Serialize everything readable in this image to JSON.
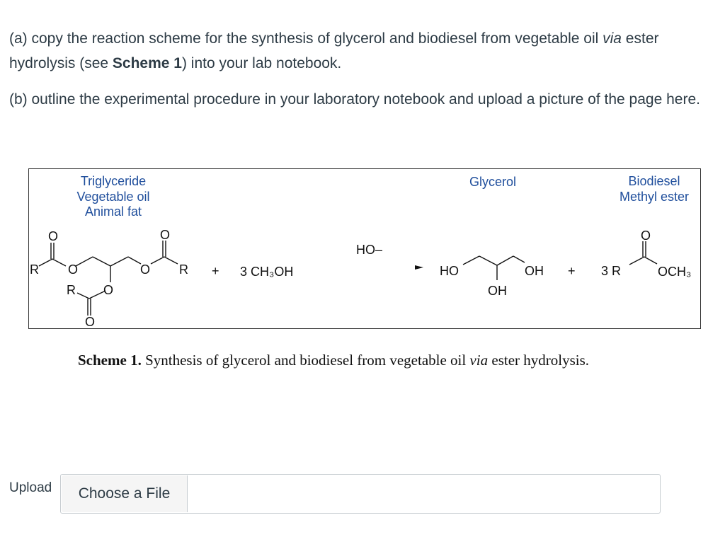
{
  "question_a": {
    "prefix": "(a) copy the reaction scheme for the synthesis of glycerol and biodiesel from vegetable oil ",
    "via": "via",
    "middle": " ester hydrolysis (see ",
    "scheme_ref": "Scheme 1",
    "suffix": ") into your lab notebook."
  },
  "question_b": "(b) outline the experimental procedure in your laboratory notebook and upload a picture of the page here.",
  "scheme": {
    "triglyceride_labels": [
      "Triglyceride",
      "Vegetable oil",
      "Animal fat"
    ],
    "glycerol_label": "Glycerol",
    "biodiesel_labels": [
      "Biodiesel",
      "Methyl ester"
    ],
    "atoms": {
      "R": "R",
      "O": "O",
      "OH": "OH",
      "HO": "HO",
      "HO_dash": "HO–",
      "plus": "+",
      "methanol": "3 CH₃OH",
      "three_r": "3 R",
      "och3": "OCH₃"
    }
  },
  "caption": {
    "bold": "Scheme 1.",
    "text_before": " Synthesis of glycerol and biodiesel from vegetable oil ",
    "italic": "via",
    "text_after": " ester hydrolysis."
  },
  "upload": {
    "label": "Upload",
    "button": "Choose a File"
  }
}
